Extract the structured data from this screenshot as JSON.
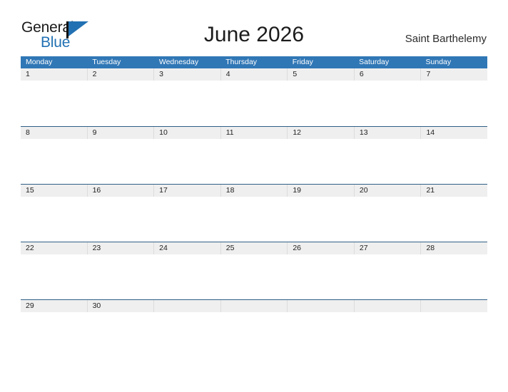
{
  "brand": {
    "word_one": "General",
    "word_two": "Blue",
    "triangle_icon": "triangle-icon",
    "accent_color": "#2271b3"
  },
  "header": {
    "title": "June 2026",
    "region": "Saint Barthelemy"
  },
  "calendar": {
    "header_bg": "#3077b6",
    "date_band_bg": "#efefef",
    "row_border": "#2e5f86",
    "weekdays": [
      "Monday",
      "Tuesday",
      "Wednesday",
      "Thursday",
      "Friday",
      "Saturday",
      "Sunday"
    ],
    "weeks": [
      [
        "1",
        "2",
        "3",
        "4",
        "5",
        "6",
        "7"
      ],
      [
        "8",
        "9",
        "10",
        "11",
        "12",
        "13",
        "14"
      ],
      [
        "15",
        "16",
        "17",
        "18",
        "19",
        "20",
        "21"
      ],
      [
        "22",
        "23",
        "24",
        "25",
        "26",
        "27",
        "28"
      ],
      [
        "29",
        "30",
        "",
        "",
        "",
        "",
        ""
      ]
    ]
  }
}
